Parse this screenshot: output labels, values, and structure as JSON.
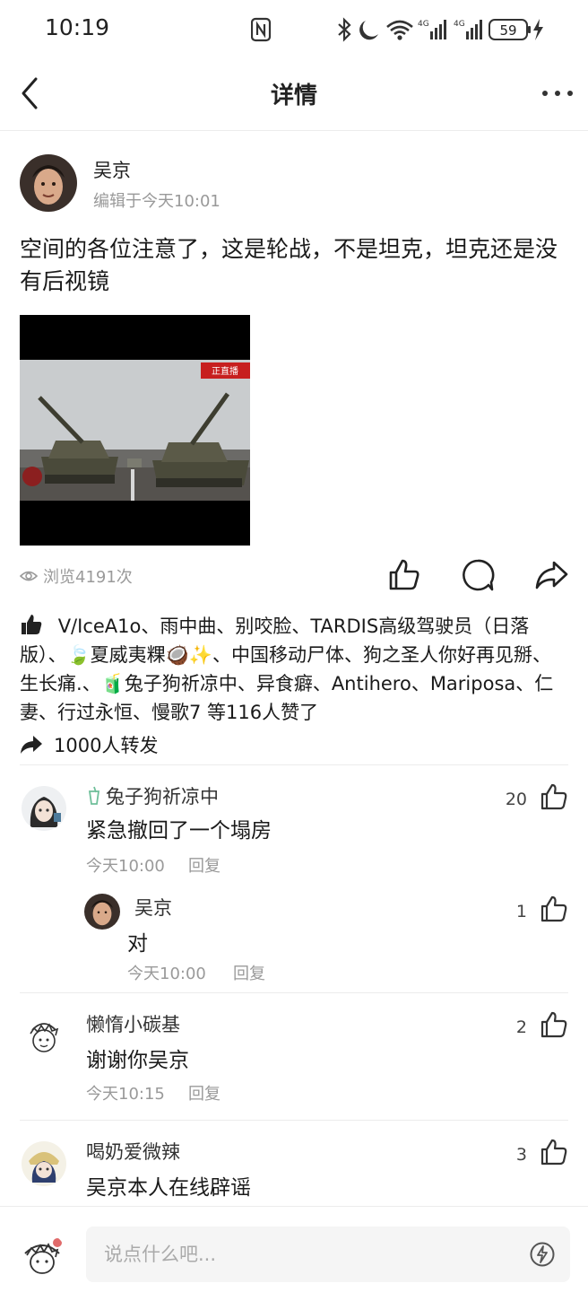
{
  "status_bar": {
    "time": "10:19",
    "network_1": "4G",
    "network_2": "4G",
    "battery": "59"
  },
  "nav": {
    "title": "详情"
  },
  "post": {
    "author": "吴京",
    "edited_time": "编辑于今天10:01",
    "text": "空间的各位注意了，这是轮战，不是坦克，坦克还是没有后视镜",
    "media_badge": "正直播",
    "views": "浏览4191次"
  },
  "likes": {
    "text": "V/IceA1o、雨中曲、别咬脸、TARDIS高级驾驶员（日落版）、🍃夏威夷粿🥥✨、中国移动尸体、狗之圣人你好再见掰、生长痛.、🧃兔子狗祈凉中、异食癖、Antihero、Mariposa、仁妻、行过永恒、慢歌7 等116人赞了"
  },
  "reposts": {
    "text": "1000人转发"
  },
  "comments": [
    {
      "name": "兔子狗祈凉中",
      "text": "紧急撤回了一个塌房",
      "time": "今天10:00",
      "reply_label": "回复",
      "likes": "20",
      "reply": {
        "name": "吴京",
        "text": "对",
        "time": "今天10:00",
        "reply_label": "回复",
        "likes": "1"
      }
    },
    {
      "name": "懒惰小碳基",
      "text": "谢谢你吴京",
      "time": "今天10:15",
      "reply_label": "回复",
      "likes": "2"
    },
    {
      "name": "喝奶爱微辣",
      "text": "吴京本人在线辟谣",
      "likes": "3"
    }
  ],
  "comment_input": {
    "placeholder": "说点什么吧..."
  },
  "colors": {
    "text_primary": "#1a1a1a",
    "text_secondary": "#9a9a9a",
    "divider": "#ececec",
    "input_bg": "#f5f5f5"
  }
}
